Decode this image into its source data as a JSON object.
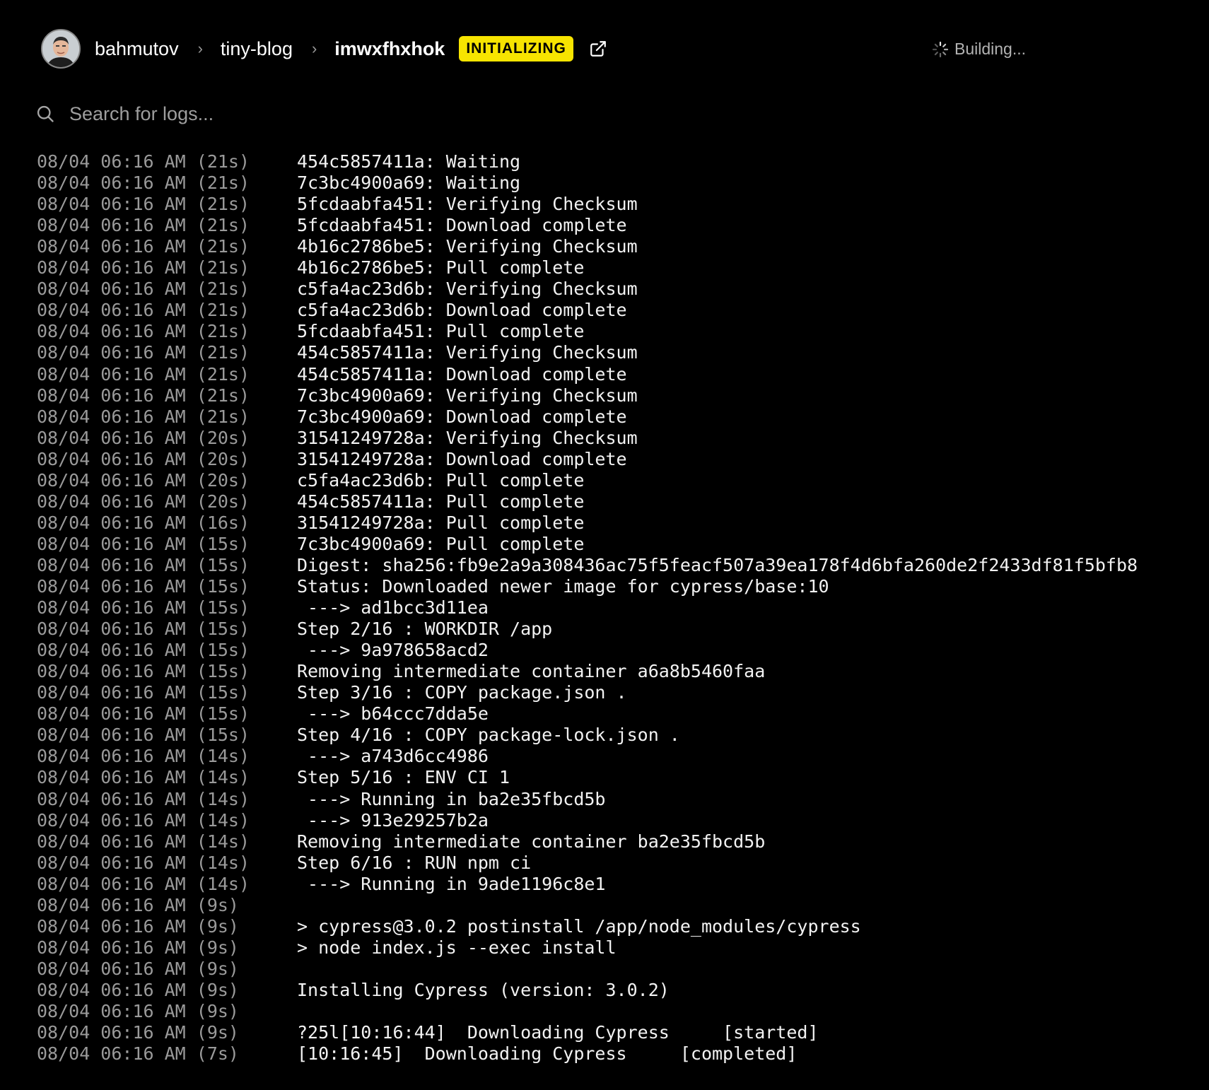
{
  "header": {
    "user": "bahmutov",
    "project": "tiny-blog",
    "deployment": "imwxfhxhok",
    "badge": "INITIALIZING",
    "status_text": "Building...",
    "badge_color": "#f7e400"
  },
  "search": {
    "placeholder": "Search for logs..."
  },
  "logs": [
    {
      "time": "08/04 06:16 AM (21s)",
      "msg": "454c5857411a: Waiting"
    },
    {
      "time": "08/04 06:16 AM (21s)",
      "msg": "7c3bc4900a69: Waiting"
    },
    {
      "time": "08/04 06:16 AM (21s)",
      "msg": "5fcdaabfa451: Verifying Checksum"
    },
    {
      "time": "08/04 06:16 AM (21s)",
      "msg": "5fcdaabfa451: Download complete"
    },
    {
      "time": "08/04 06:16 AM (21s)",
      "msg": "4b16c2786be5: Verifying Checksum"
    },
    {
      "time": "08/04 06:16 AM (21s)",
      "msg": "4b16c2786be5: Pull complete"
    },
    {
      "time": "08/04 06:16 AM (21s)",
      "msg": "c5fa4ac23d6b: Verifying Checksum"
    },
    {
      "time": "08/04 06:16 AM (21s)",
      "msg": "c5fa4ac23d6b: Download complete"
    },
    {
      "time": "08/04 06:16 AM (21s)",
      "msg": "5fcdaabfa451: Pull complete"
    },
    {
      "time": "08/04 06:16 AM (21s)",
      "msg": "454c5857411a: Verifying Checksum"
    },
    {
      "time": "08/04 06:16 AM (21s)",
      "msg": "454c5857411a: Download complete"
    },
    {
      "time": "08/04 06:16 AM (21s)",
      "msg": "7c3bc4900a69: Verifying Checksum"
    },
    {
      "time": "08/04 06:16 AM (21s)",
      "msg": "7c3bc4900a69: Download complete"
    },
    {
      "time": "08/04 06:16 AM (20s)",
      "msg": "31541249728a: Verifying Checksum"
    },
    {
      "time": "08/04 06:16 AM (20s)",
      "msg": "31541249728a: Download complete"
    },
    {
      "time": "08/04 06:16 AM (20s)",
      "msg": "c5fa4ac23d6b: Pull complete"
    },
    {
      "time": "08/04 06:16 AM (20s)",
      "msg": "454c5857411a: Pull complete"
    },
    {
      "time": "08/04 06:16 AM (16s)",
      "msg": "31541249728a: Pull complete"
    },
    {
      "time": "08/04 06:16 AM (15s)",
      "msg": "7c3bc4900a69: Pull complete"
    },
    {
      "time": "08/04 06:16 AM (15s)",
      "msg": "Digest: sha256:fb9e2a9a308436ac75f5feacf507a39ea178f4d6bfa260de2f2433df81f5bfb8"
    },
    {
      "time": "08/04 06:16 AM (15s)",
      "msg": "Status: Downloaded newer image for cypress/base:10"
    },
    {
      "time": "08/04 06:16 AM (15s)",
      "msg": " ---> ad1bcc3d11ea"
    },
    {
      "time": "08/04 06:16 AM (15s)",
      "msg": "Step 2/16 : WORKDIR /app"
    },
    {
      "time": "08/04 06:16 AM (15s)",
      "msg": " ---> 9a978658acd2"
    },
    {
      "time": "08/04 06:16 AM (15s)",
      "msg": "Removing intermediate container a6a8b5460faa"
    },
    {
      "time": "08/04 06:16 AM (15s)",
      "msg": "Step 3/16 : COPY package.json ."
    },
    {
      "time": "08/04 06:16 AM (15s)",
      "msg": " ---> b64ccc7dda5e"
    },
    {
      "time": "08/04 06:16 AM (15s)",
      "msg": "Step 4/16 : COPY package-lock.json ."
    },
    {
      "time": "08/04 06:16 AM (14s)",
      "msg": " ---> a743d6cc4986"
    },
    {
      "time": "08/04 06:16 AM (14s)",
      "msg": "Step 5/16 : ENV CI 1"
    },
    {
      "time": "08/04 06:16 AM (14s)",
      "msg": " ---> Running in ba2e35fbcd5b"
    },
    {
      "time": "08/04 06:16 AM (14s)",
      "msg": " ---> 913e29257b2a"
    },
    {
      "time": "08/04 06:16 AM (14s)",
      "msg": "Removing intermediate container ba2e35fbcd5b"
    },
    {
      "time": "08/04 06:16 AM (14s)",
      "msg": "Step 6/16 : RUN npm ci"
    },
    {
      "time": "08/04 06:16 AM (14s)",
      "msg": " ---> Running in 9ade1196c8e1"
    },
    {
      "time": "08/04 06:16 AM (9s)",
      "msg": ""
    },
    {
      "time": "08/04 06:16 AM (9s)",
      "msg": "> cypress@3.0.2 postinstall /app/node_modules/cypress"
    },
    {
      "time": "08/04 06:16 AM (9s)",
      "msg": "> node index.js --exec install"
    },
    {
      "time": "08/04 06:16 AM (9s)",
      "msg": ""
    },
    {
      "time": "08/04 06:16 AM (9s)",
      "msg": "Installing Cypress (version: 3.0.2)"
    },
    {
      "time": "08/04 06:16 AM (9s)",
      "msg": ""
    },
    {
      "time": "08/04 06:16 AM (9s)",
      "msg": "?25l[10:16:44]  Downloading Cypress     [started]"
    },
    {
      "time": "08/04 06:16 AM (7s)",
      "msg": "[10:16:45]  Downloading Cypress     [completed]"
    }
  ]
}
